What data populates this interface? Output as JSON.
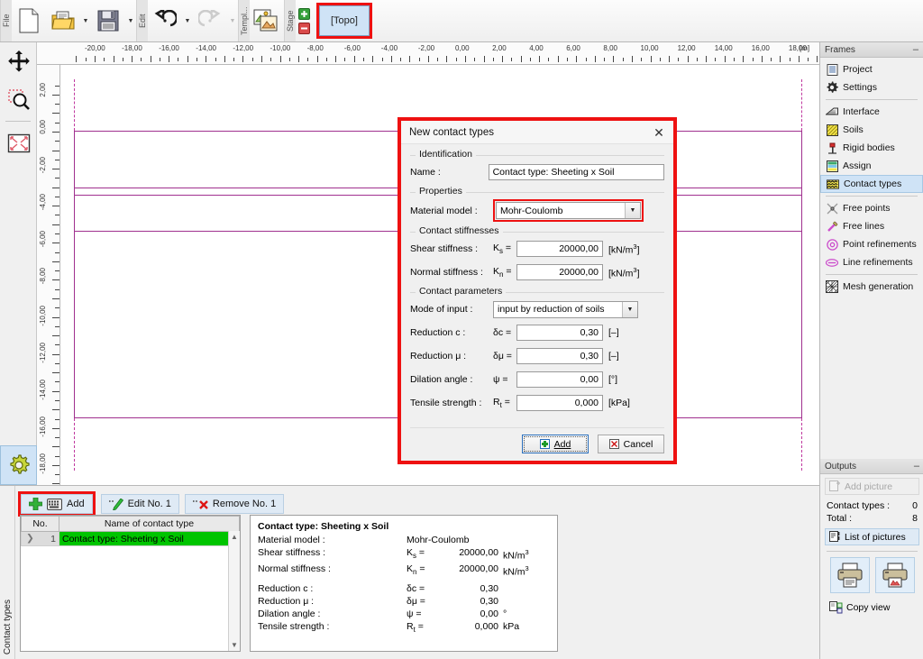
{
  "toolbar": {
    "groups": [
      {
        "caption": "File",
        "buttons": [
          "new-file-icon",
          "open-folder-icon",
          "save-disk-icon"
        ]
      },
      {
        "caption": "Edit",
        "buttons": [
          "undo-icon",
          "redo-icon"
        ]
      },
      {
        "caption": "Templ...",
        "buttons": [
          "templates-icon"
        ]
      },
      {
        "caption": "Stage",
        "buttons": [
          "stage-add-icon",
          "stage-remove-icon"
        ]
      }
    ],
    "topo_label": "[Topo]"
  },
  "left_tools": {
    "items": [
      "pan-icon",
      "zoom-window-icon",
      "zoom-extents-icon"
    ],
    "settings": "gear-icon"
  },
  "rulers": {
    "unit": "[m]",
    "horizontal_labels": [
      "-20,00",
      "-18,00",
      "-16,00",
      "-14,00",
      "-12,00",
      "-10,00",
      "-8,00",
      "-6,00",
      "-4,00",
      "-2,00",
      "0,00",
      "2,00",
      "4,00",
      "6,00",
      "8,00",
      "10,00",
      "12,00",
      "14,00",
      "16,00",
      "18,00"
    ],
    "vertical_labels": [
      "2,00",
      "0,00",
      "-2,00",
      "-4,00",
      "-6,00",
      "-8,00",
      "-10,00",
      "-12,00",
      "-14,00",
      "-16,00",
      "-18,00"
    ]
  },
  "dialog": {
    "title": "New contact types",
    "close_icon": "✕",
    "groups": {
      "identification": "Identification",
      "properties": "Properties",
      "contact_stiffnesses": "Contact stiffnesses",
      "contact_parameters": "Contact parameters"
    },
    "name": {
      "label": "Name :",
      "value": "Contact type: Sheeting x Soil"
    },
    "material_model": {
      "label": "Material model :",
      "value": "Mohr-Coulomb"
    },
    "shear_stiffness": {
      "label": "Shear stiffness :",
      "symbol": "K",
      "sub": "s",
      "eq": "=",
      "value": "20000,00",
      "unit": "[kN/m",
      "unit_sup": "3",
      "unit_end": "]"
    },
    "normal_stiffness": {
      "label": "Normal stiffness :",
      "symbol": "K",
      "sub": "n",
      "eq": "=",
      "value": "20000,00",
      "unit": "[kN/m",
      "unit_sup": "3",
      "unit_end": "]"
    },
    "mode_of_input": {
      "label": "Mode of input :",
      "value": "input by reduction of soils"
    },
    "reduction_c": {
      "label": "Reduction c :",
      "symbol": "δc =",
      "value": "0,30",
      "unit": "[–]"
    },
    "reduction_mu": {
      "label": "Reduction μ :",
      "symbol": "δμ =",
      "value": "0,30",
      "unit": "[–]"
    },
    "dilation_angle": {
      "label": "Dilation angle :",
      "symbol": "ψ =",
      "value": "0,00",
      "unit": "[°]"
    },
    "tensile_strength": {
      "label": "Tensile strength :",
      "symbol": "R",
      "sub": "t",
      "eq": "=",
      "value": "0,000",
      "unit": "[kPa]"
    },
    "add_button": "Add",
    "cancel_button": "Cancel"
  },
  "bottom": {
    "vertical_tab": "Contact types",
    "buttons": {
      "add": "Add",
      "edit": "Edit No. 1",
      "remove": "Remove No. 1"
    },
    "table": {
      "headers": [
        "No.",
        "Name of contact type"
      ],
      "rows": [
        {
          "no": "1",
          "name": "Contact type: Sheeting x Soil",
          "selected": true
        }
      ]
    },
    "detail": {
      "title": "Contact type: Sheeting x Soil",
      "lines": [
        {
          "label": "Material model :",
          "symbol": "",
          "value": "Mohr-Coulomb",
          "unit": "",
          "left_value": true
        },
        {
          "label": "Shear stiffness :",
          "symbol": "Ks  =",
          "value": "20000,00",
          "unit": "kN/m3"
        },
        {
          "label": "Normal stiffness :",
          "symbol": "Kn  =",
          "value": "20000,00",
          "unit": "kN/m3"
        },
        {
          "label": "Reduction c :",
          "symbol": "δc  =",
          "value": "0,30",
          "unit": ""
        },
        {
          "label": "Reduction μ :",
          "symbol": "δμ =",
          "value": "0,30",
          "unit": ""
        },
        {
          "label": "Dilation angle :",
          "symbol": "ψ  =",
          "value": "0,00",
          "unit": "°"
        },
        {
          "label": "Tensile strength :",
          "symbol": "Rt  =",
          "value": "0,000",
          "unit": "kPa"
        }
      ]
    }
  },
  "frames": {
    "title": "Frames",
    "minimize": "–",
    "items": [
      {
        "label": "Project",
        "icon": "project-icon"
      },
      {
        "label": "Settings",
        "icon": "settings-gear-icon"
      },
      {
        "sep": true
      },
      {
        "label": "Interface",
        "icon": "interface-icon"
      },
      {
        "label": "Soils",
        "icon": "soils-icon"
      },
      {
        "label": "Rigid bodies",
        "icon": "rigid-bodies-icon"
      },
      {
        "label": "Assign",
        "icon": "assign-icon"
      },
      {
        "label": "Contact types",
        "icon": "contact-types-icon",
        "active": true
      },
      {
        "sep": true
      },
      {
        "label": "Free points",
        "icon": "free-points-icon"
      },
      {
        "label": "Free lines",
        "icon": "free-lines-icon"
      },
      {
        "label": "Point refinements",
        "icon": "point-refinements-icon"
      },
      {
        "label": "Line refinements",
        "icon": "line-refinements-icon"
      },
      {
        "sep": true
      },
      {
        "label": "Mesh generation",
        "icon": "mesh-generation-icon"
      }
    ]
  },
  "outputs": {
    "title": "Outputs",
    "minimize": "–",
    "add_picture": "Add picture",
    "contact_types_label": "Contact types :",
    "contact_types_value": "0",
    "total_label": "Total :",
    "total_value": "8",
    "list_of_pictures": "List of pictures",
    "copy_view": "Copy view"
  },
  "colors": {
    "highlight_red": "#ee1111",
    "selection_green": "#00c400",
    "accent_blue": "#cfe3f6",
    "soil_line": "#a0308f"
  }
}
